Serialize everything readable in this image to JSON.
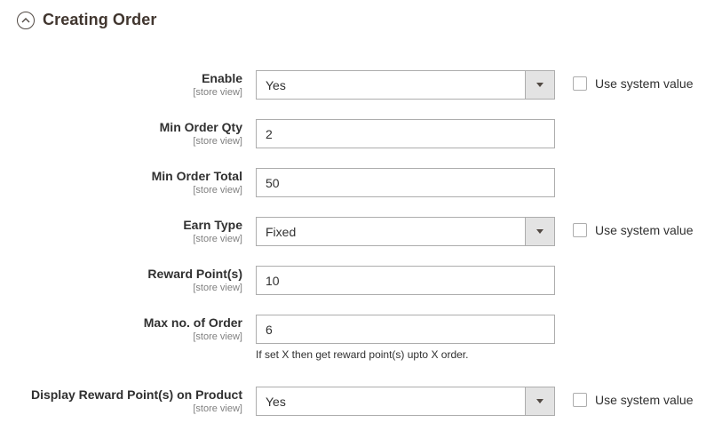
{
  "section": {
    "title": "Creating Order",
    "icon": "chevron-up-circle-icon"
  },
  "fields": {
    "enable": {
      "label": "Enable",
      "scope": "[store view]",
      "value": "Yes",
      "use_system": "Use system value"
    },
    "min_order_qty": {
      "label": "Min Order Qty",
      "scope": "[store view]",
      "value": "2"
    },
    "min_order_total": {
      "label": "Min Order Total",
      "scope": "[store view]",
      "value": "50"
    },
    "earn_type": {
      "label": "Earn Type",
      "scope": "[store view]",
      "value": "Fixed",
      "use_system": "Use system value"
    },
    "reward_points": {
      "label": "Reward Point(s)",
      "scope": "[store view]",
      "value": "10"
    },
    "max_orders": {
      "label": "Max no. of Order",
      "scope": "[store view]",
      "value": "6",
      "note": "If set X then get reward point(s) upto X order."
    },
    "display_reward": {
      "label": "Display Reward Point(s) on Product",
      "scope": "[store view]",
      "value": "Yes",
      "use_system": "Use system value"
    }
  }
}
